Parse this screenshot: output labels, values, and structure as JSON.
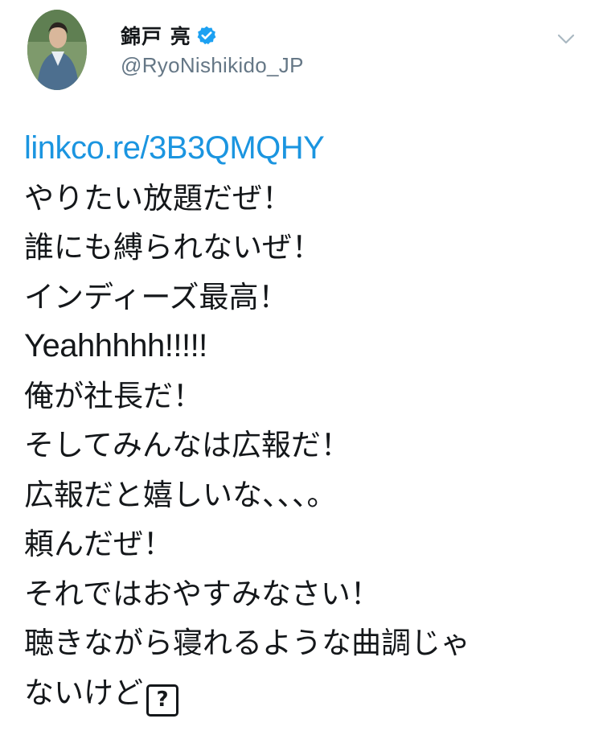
{
  "tweet": {
    "author": {
      "display_name": "錦戸 亮",
      "handle": "@RyoNishikido_JP",
      "verified": true,
      "verified_icon": "verified-badge-icon",
      "avatar_icon": "avatar"
    },
    "menu_icon": "chevron-down-icon",
    "link_text": "linkco.re/3B3QMQHY",
    "lines": [
      "やりたい放題だぜ！",
      "誰にも縛られないぜ！",
      "インディーズ最高！",
      "Yeahhhhh!!!!!",
      "俺が社長だ！",
      "そしてみんなは広報だ！",
      "広報だと嬉しいな、、、。",
      "頼んだぜ！",
      "それではおやすみなさい！",
      "聴きながら寝れるような曲調じゃ",
      "ないけど"
    ],
    "trailing_glyph": "?",
    "colors": {
      "link": "#1b95e0",
      "verified": "#1da1f2",
      "text": "#14171a",
      "secondary": "#657786"
    }
  }
}
